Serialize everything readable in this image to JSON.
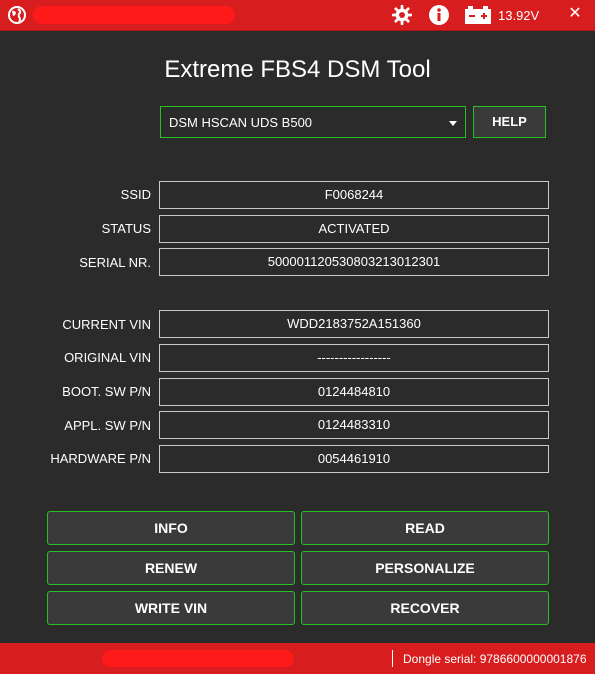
{
  "titlebar": {
    "voltage": "13.92V",
    "close_glyph": "✕",
    "icons": [
      "globe-icon",
      "gear-icon",
      "info-icon",
      "battery-icon",
      "close-icon"
    ],
    "accent_color": "#d71d1d"
  },
  "app": {
    "title": "Extreme FBS4 DSM Tool"
  },
  "controls": {
    "protocol_selected": "DSM HSCAN UDS B500",
    "help_label": "HELP",
    "border_color": "#27c127"
  },
  "fields": [
    {
      "label": "SSID",
      "value": "F0068244"
    },
    {
      "label": "STATUS",
      "value": "ACTIVATED"
    },
    {
      "label": "SERIAL NR.",
      "value": "50000112053080321301230​1"
    },
    {
      "label": "CURRENT VIN",
      "value": "WDD2183752A151360"
    },
    {
      "label": "ORIGINAL VIN",
      "value": "-----------------"
    },
    {
      "label": "BOOT. SW P/N",
      "value": "0124484810"
    },
    {
      "label": "APPL. SW P/N",
      "value": "0124483310"
    },
    {
      "label": "HARDWARE P/N",
      "value": "0054461910"
    }
  ],
  "buttons": {
    "info": "INFO",
    "read": "READ",
    "renew": "RENEW",
    "personalize": "PERSONALIZE",
    "write_vin": "WRITE VIN",
    "recover": "RECOVER"
  },
  "statusbar": {
    "dongle_serial": "Dongle serial: 9786600000001876"
  }
}
